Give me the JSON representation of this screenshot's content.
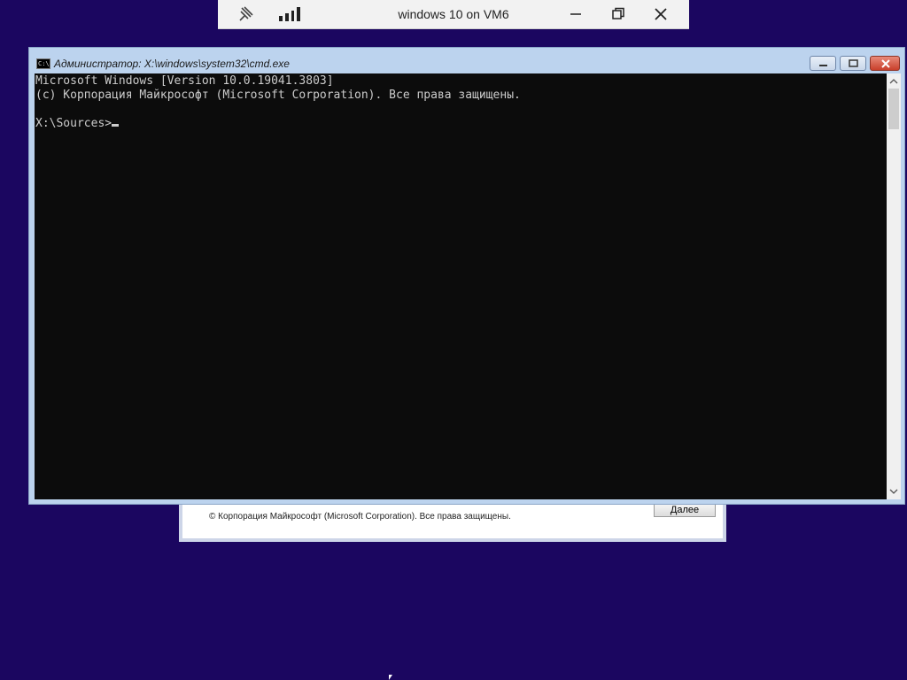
{
  "remote_bar": {
    "title": "windows 10 on VM6",
    "icons": [
      "pin-icon",
      "signal-icon",
      "minimize-icon",
      "restore-icon",
      "close-icon"
    ]
  },
  "setup_dialog": {
    "copyright": "© Корпорация Майкрософт (Microsoft Corporation). Все права защищены.",
    "next_label": "Далее"
  },
  "cmd_window": {
    "title": "Администратор: X:\\windows\\system32\\cmd.exe",
    "icon_text": "C:\\",
    "console_lines": [
      "Microsoft Windows [Version 10.0.19041.3803]",
      "(c) Корпорация Майкрософт (Microsoft Corporation). Все права защищены.",
      "",
      "X:\\Sources>"
    ]
  },
  "colors": {
    "desktop": "#1b0660",
    "console_bg": "#0c0c0c",
    "console_fg": "#cccccc",
    "window_frame": "#bcd3ee"
  }
}
